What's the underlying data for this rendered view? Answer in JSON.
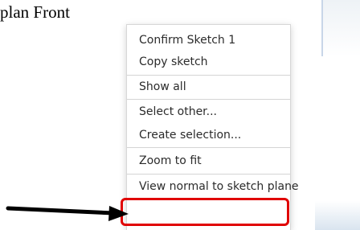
{
  "document": {
    "text": "plan Front"
  },
  "context_menu": {
    "items": [
      {
        "label": "Confirm Sketch 1"
      },
      {
        "label": "Copy sketch"
      },
      {
        "label": "Show all"
      },
      {
        "label": "Select other..."
      },
      {
        "label": "Create selection..."
      },
      {
        "label": "Zoom to fit"
      },
      {
        "label": "View normal to sketch plane"
      }
    ]
  },
  "annotation": {
    "highlight_color": "#e00000",
    "arrow_color": "#000000",
    "highlighted_item": "View normal to sketch plane"
  }
}
